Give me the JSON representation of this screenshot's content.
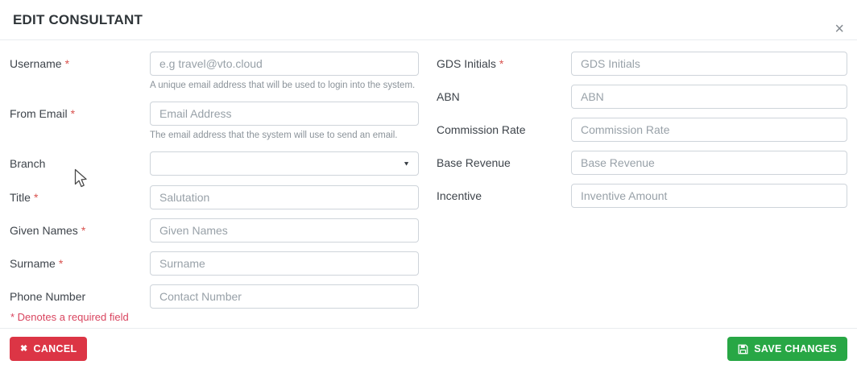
{
  "modal": {
    "title": "EDIT CONSULTANT",
    "close_glyph": "×"
  },
  "fields": {
    "left": [
      {
        "label": "Username",
        "marker": "*",
        "placeholder": "e.g travel@vto.cloud",
        "helper": "A unique email address that will be used to login into the system."
      },
      {
        "label": "From Email",
        "marker": "*",
        "placeholder": "Email Address",
        "helper": "The email address that the system will use to send an email."
      },
      {
        "label": "Branch",
        "selected_value": ""
      },
      {
        "label": "Title",
        "marker": "*",
        "placeholder": "Salutation"
      },
      {
        "label": "Given Names",
        "marker": "*",
        "placeholder": "Given Names"
      },
      {
        "label": "Surname",
        "marker": "*",
        "placeholder": "Surname"
      },
      {
        "label": "Phone Number",
        "placeholder": "Contact Number"
      }
    ],
    "right": [
      {
        "label": "GDS Initials",
        "marker": "*",
        "placeholder": "GDS Initials"
      },
      {
        "label": "ABN",
        "placeholder": "ABN"
      },
      {
        "label": "Commission Rate",
        "placeholder": "Commission Rate"
      },
      {
        "label": "Base Revenue",
        "placeholder": "Base Revenue"
      },
      {
        "label": "Incentive",
        "placeholder": "Inventive Amount"
      }
    ],
    "required_note": "* Denotes a required field"
  },
  "footer": {
    "cancel_label": "CANCEL",
    "save_label": "SAVE CHANGES"
  },
  "icons": {
    "cancel_glyph": "✖",
    "dropdown_glyph": "▼"
  },
  "colors": {
    "danger": "#dc3545",
    "success": "#28a745",
    "input_border": "#ced4da",
    "divider": "#e9ecef",
    "label_text": "#3e444b",
    "helper_text": "#8b939a",
    "placeholder_text": "#98a1a8",
    "required_red": "#d9534f"
  }
}
